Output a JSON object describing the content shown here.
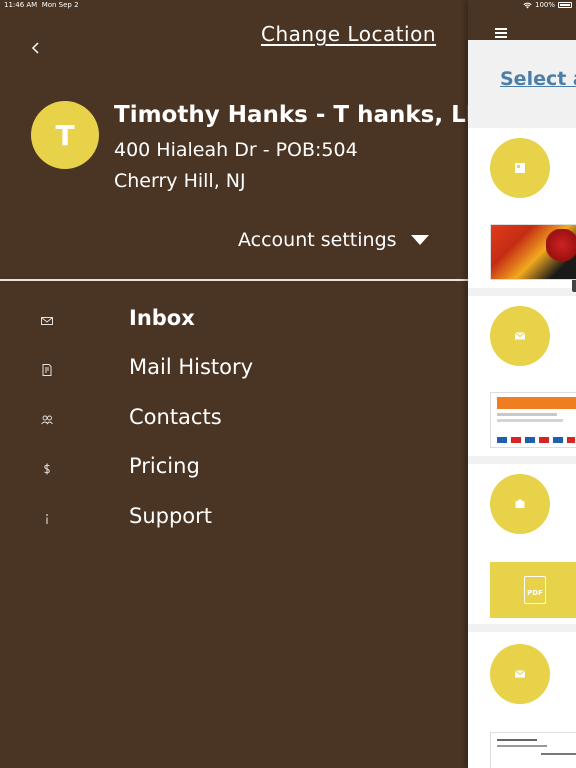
{
  "status_bar": {
    "time": "11:46 AM",
    "date": "Mon Sep 2",
    "battery": "100%"
  },
  "drawer": {
    "change_location": "Change Location",
    "account": {
      "avatar_initial": "T",
      "name": "Timothy Hanks - T hanks, LLC",
      "address": "400 Hialeah Dr - POB:504",
      "city": "Cherry Hill, NJ"
    },
    "account_settings_label": "Account settings",
    "menu": [
      {
        "label": "Inbox",
        "icon": "envelope-icon",
        "active": true
      },
      {
        "label": "Mail History",
        "icon": "document-icon",
        "active": false
      },
      {
        "label": "Contacts",
        "icon": "people-icon",
        "active": false
      },
      {
        "label": "Pricing",
        "icon": "dollar-icon",
        "active": false
      },
      {
        "label": "Support",
        "icon": "info-icon",
        "active": false
      }
    ]
  },
  "main": {
    "select_link": "Select a",
    "pdf_label": "PDF",
    "colors": {
      "header_brown": "#4a3423",
      "avatar_yellow": "#e8d24a",
      "link_blue": "#4b7ea8"
    }
  }
}
